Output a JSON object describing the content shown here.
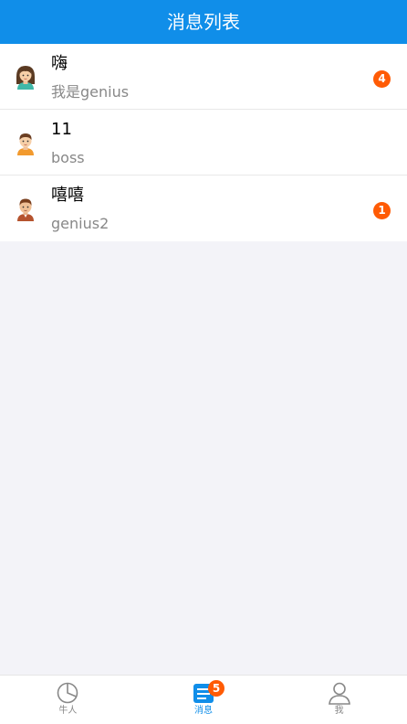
{
  "header": {
    "title": "消息列表"
  },
  "messages": [
    {
      "name": "嗨",
      "subtitle": "我是genius",
      "unread": "4",
      "avatar": "girl-avatar-icon"
    },
    {
      "name": "11",
      "subtitle": "boss",
      "unread": "",
      "avatar": "boy-avatar-icon"
    },
    {
      "name": "嘻嘻",
      "subtitle": "genius2",
      "unread": "1",
      "avatar": "man-avatar-icon"
    }
  ],
  "tabbar": {
    "tabs": [
      {
        "label": "牛人",
        "icon": "pie-chart-icon",
        "active": false,
        "badge": ""
      },
      {
        "label": "消息",
        "icon": "message-list-icon",
        "active": true,
        "badge": "5"
      },
      {
        "label": "我",
        "icon": "user-icon",
        "active": false,
        "badge": ""
      }
    ]
  },
  "colors": {
    "header_bg": "#108ee9",
    "badge": "#ff5b05",
    "page_bg": "#f3f3f8",
    "active_tab": "#108ee9"
  }
}
